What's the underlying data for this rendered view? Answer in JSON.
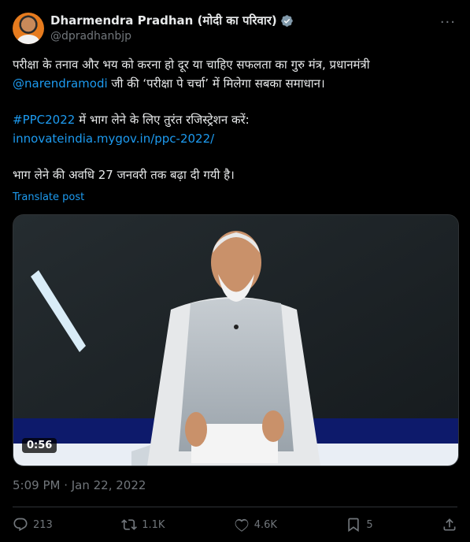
{
  "author": {
    "name": "Dharmendra Pradhan (मोदी का परिवार)",
    "handle": "@dpradhanbjp"
  },
  "post": {
    "line1": "परीक्षा के तनाव और भय को करना हो दूर या चाहिए सफलता का गुरु मंत्र, प्रधानमंत्री",
    "mention": "@narendramodi",
    "line2_rest": " जी की ‘परीक्षा पे चर्चा’ में मिलेगा सबका समाधान।",
    "hashtag": "#PPC2022",
    "line3_rest": " में भाग लेने के लिए तुरंत रजिस्ट्रेशन करें:",
    "url": "innovateindia.mygov.in/ppc-2022/",
    "line5": "भाग लेने की अवधि 27 जनवरी तक बढ़ा दी गयी है।",
    "translate_label": "Translate post"
  },
  "media": {
    "duration": "0:56"
  },
  "timestamp": "5:09 PM · Jan 22, 2022",
  "actions": {
    "replies": "213",
    "reposts": "1.1K",
    "likes": "4.6K",
    "bookmarks": "5"
  },
  "colors": {
    "accent": "#1d9bf0",
    "muted": "#71767b",
    "background": "#000000"
  }
}
